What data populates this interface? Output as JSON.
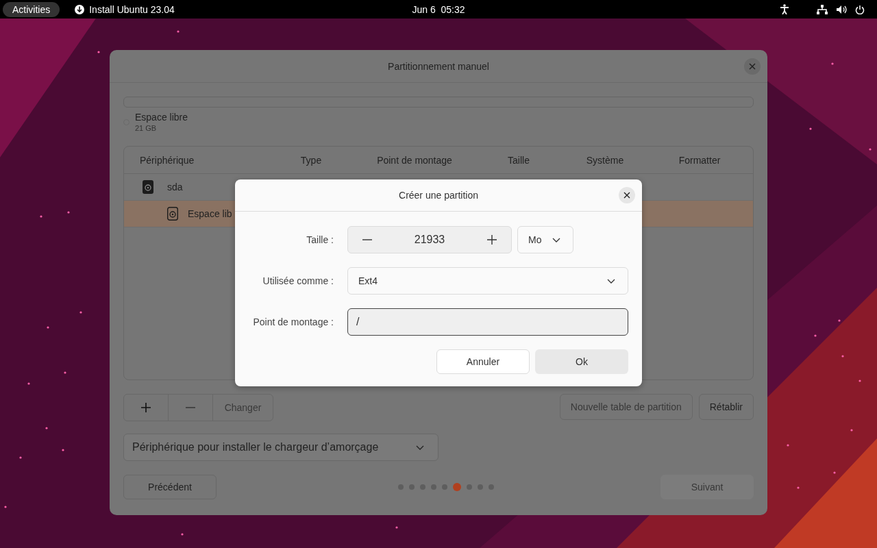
{
  "top_bar": {
    "activities": "Activities",
    "app": "Install Ubuntu 23.04",
    "clock": "Jun 6  05:32"
  },
  "window": {
    "title": "Partitionnement manuel",
    "legend": [
      {
        "name": "Espace libre",
        "size": "21 GB",
        "selected": false
      }
    ],
    "table": {
      "columns": [
        "Périphérique",
        "Type",
        "Point de montage",
        "Taille",
        "Système",
        "Formatter"
      ],
      "rows": [
        {
          "device": "sda",
          "selected": false,
          "children": [
            {
              "device": "Espace lib",
              "selected": true
            }
          ]
        }
      ]
    },
    "toolbar": {
      "add": {
        "disabled": false
      },
      "remove": {
        "disabled": true
      },
      "change": {
        "label": "Changer",
        "disabled": true
      }
    },
    "right_buttons": [
      {
        "label": "Nouvelle table de partition",
        "disabled": true
      },
      {
        "label": "Rétablir",
        "disabled": false
      }
    ],
    "bootloader": "Périphérique pour installer le chargeur d’amorçage",
    "back": {
      "label": "Précédent",
      "disabled": false
    },
    "next": {
      "label": "Suivant",
      "disabled": true
    },
    "steps": [
      {
        "selected": false
      },
      {
        "selected": false
      },
      {
        "selected": false
      },
      {
        "selected": false
      },
      {
        "selected": false
      },
      {
        "selected": true
      },
      {
        "selected": false
      },
      {
        "selected": false
      },
      {
        "selected": false
      }
    ]
  },
  "dialog": {
    "title": "Créer une partition",
    "size_label": "Taille :",
    "size": "21933",
    "unit": "Mo",
    "use_label": "Utilisée comme :",
    "use": "Ext4",
    "mount_label": "Point de montage :",
    "mount": "/",
    "buttons": [
      {
        "label": "Annuler",
        "kind": "outlined"
      },
      {
        "label": "Ok",
        "kind": "filled"
      }
    ]
  }
}
